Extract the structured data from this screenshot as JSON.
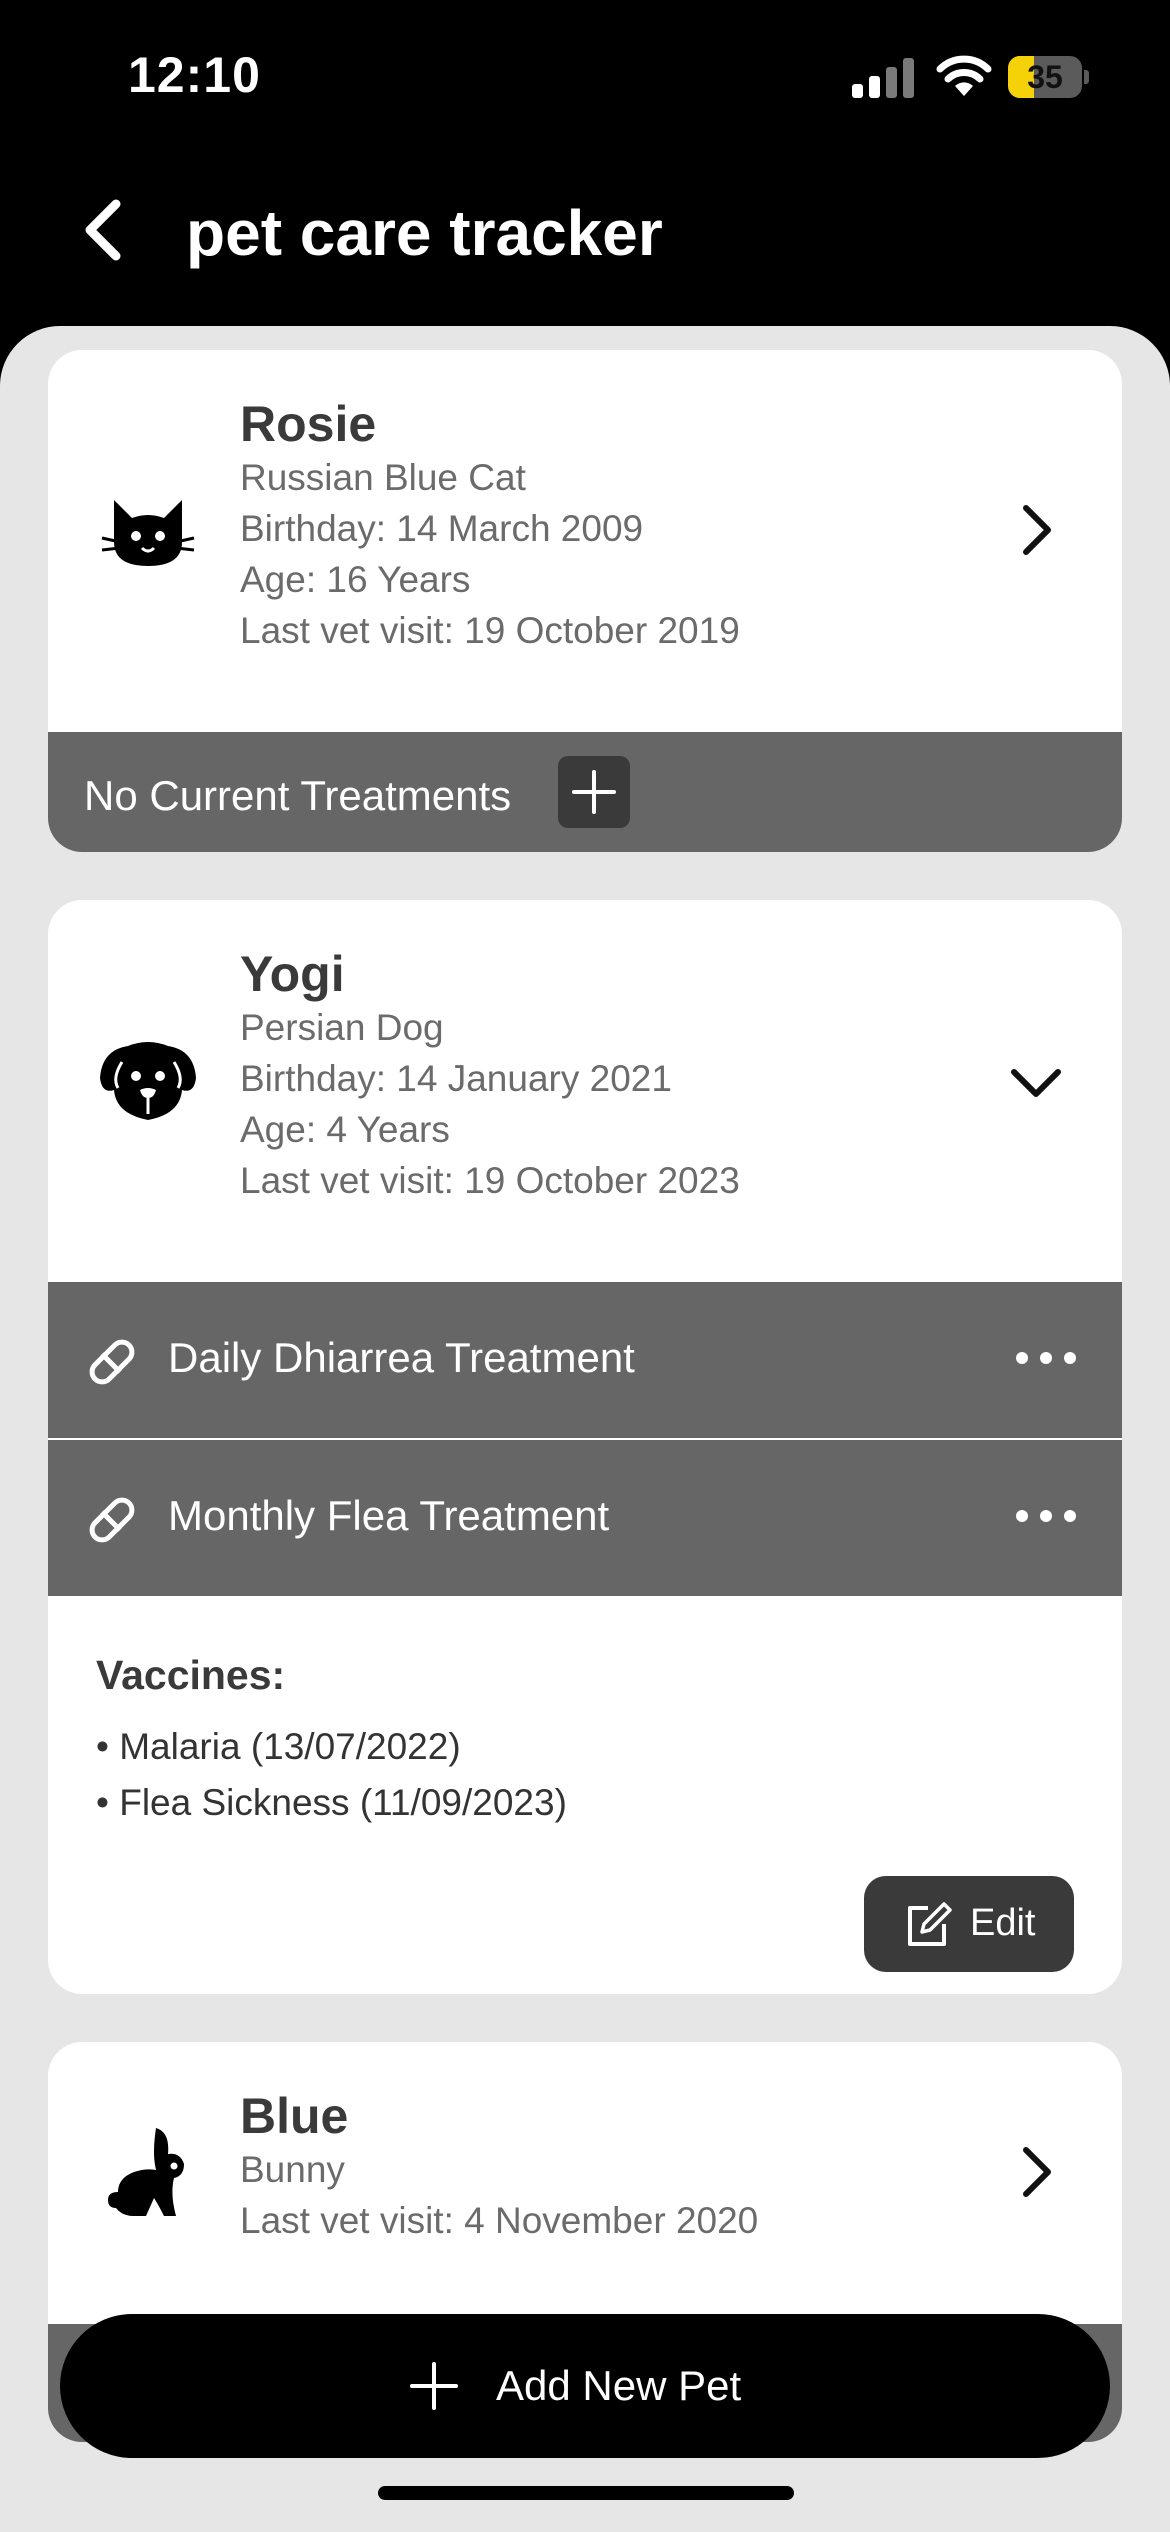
{
  "status_bar": {
    "time": "12:10",
    "battery": "35",
    "battery_level": 0.35,
    "accent": "#f5d10a"
  },
  "nav": {
    "title": "pet care tracker",
    "back_icon": "chevron-left-icon"
  },
  "pets": [
    {
      "name": "Rosie",
      "icon": "cat-icon",
      "lines": [
        "Russian Blue Cat",
        "Birthday: 14 March 2009",
        "Age: 16 Years",
        "Last vet visit: 19 October 2019"
      ],
      "chevron": "chevron-right-icon",
      "no_treatments_label": "No Current Treatments"
    },
    {
      "name": "Yogi",
      "icon": "dog-icon",
      "lines": [
        "Persian Dog",
        "Birthday: 14 January 2021",
        "Age: 4 Years",
        "Last vet visit: 19 October 2023"
      ],
      "chevron": "chevron-down-icon",
      "treatments": [
        {
          "label": "Daily Dhiarrea Treatment",
          "icon": "pill-icon"
        },
        {
          "label": "Monthly Flea Treatment",
          "icon": "pill-icon"
        }
      ],
      "vaccines_title": "Vaccines:",
      "vaccines": [
        "• Malaria (13/07/2022)",
        "• Flea Sickness (11/09/2023)"
      ],
      "edit_label": "Edit"
    },
    {
      "name": "Blue",
      "icon": "rabbit-icon",
      "lines": [
        "Bunny",
        "Last vet visit: 4 November 2020"
      ],
      "chevron": "chevron-right-icon"
    }
  ],
  "add_button": {
    "label": "Add New Pet"
  },
  "colors": {
    "background": "#e6e6e6",
    "treatment_bar": "#666666",
    "dark_button": "#3a3a3a"
  }
}
